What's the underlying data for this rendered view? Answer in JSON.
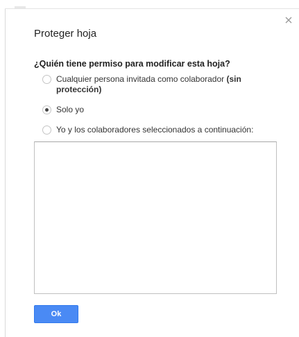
{
  "dialog": {
    "title": "Proteger hoja",
    "question": "¿Quién tiene permiso para modificar esta hoja?",
    "close_icon": "close-icon",
    "options": [
      {
        "label": "Cualquier persona invitada como colaborador",
        "label_bold": "(sin protección)",
        "selected": false
      },
      {
        "label": "Solo yo",
        "selected": true
      },
      {
        "label": "Yo y los colaboradores seleccionados a continuación:",
        "selected": false
      }
    ],
    "collaborators_text": "",
    "ok_label": "Ok"
  },
  "colors": {
    "primary_button": "#4a8af4",
    "text": "#222222"
  }
}
